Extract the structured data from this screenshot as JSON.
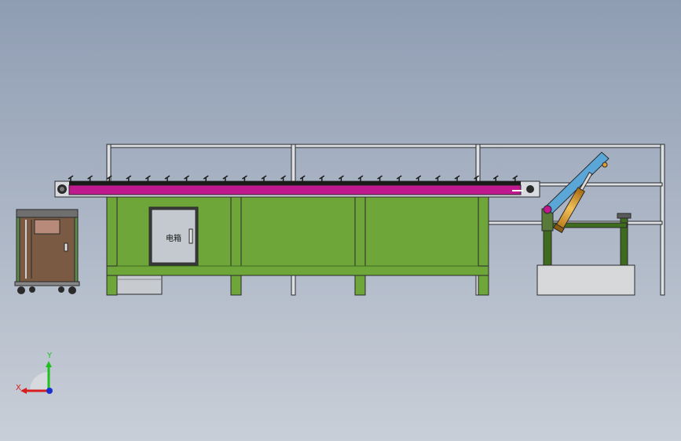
{
  "viewport": {
    "background_top": "#8f9db3",
    "background_bottom": "#c9cfd8"
  },
  "cabinet": {
    "label": "电箱"
  },
  "triad": {
    "x_label": "X",
    "y_label": "Y",
    "x_color": "#d62020",
    "y_color": "#1fbf1f",
    "z_color": "#1a2fd0"
  },
  "colors": {
    "frame_green": "#6fa63a",
    "frame_green_dark": "#3f6b1f",
    "conveyor_magenta": "#c0188e",
    "outline": "#2a2a2a",
    "rail_gray": "#dcdfe4",
    "cylinder_orange": "#e0a030",
    "arm_blue": "#5aa6d6",
    "concrete": "#d6d8da"
  }
}
